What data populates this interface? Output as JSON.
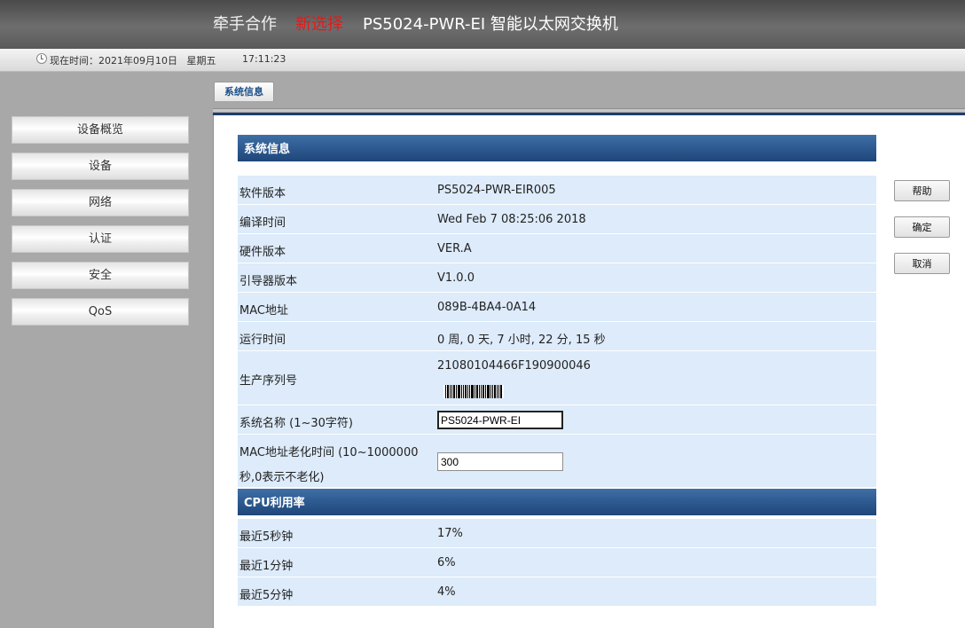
{
  "header": {
    "brand": "牵手合作",
    "brand_highlight": "新选择",
    "product": "PS5024-PWR-EI 智能以太网交换机"
  },
  "timebar": {
    "label": "现在时间：2021年09月10日   星期五",
    "time": "17:11:23"
  },
  "sidebar": {
    "items": [
      {
        "label": "设备概览"
      },
      {
        "label": "设备"
      },
      {
        "label": "网络"
      },
      {
        "label": "认证"
      },
      {
        "label": "安全"
      },
      {
        "label": "QoS"
      }
    ]
  },
  "tab": {
    "label": "系统信息"
  },
  "system_info": {
    "title": "系统信息",
    "rows": [
      {
        "label": "软件版本",
        "value": "PS5024-PWR-EIR005"
      },
      {
        "label": "编译时间",
        "value": "Wed Feb 7 08:25:06 2018"
      },
      {
        "label": "硬件版本",
        "value": "VER.A"
      },
      {
        "label": "引导器版本",
        "value": "V1.0.0"
      },
      {
        "label": "MAC地址",
        "value": "089B-4BA4-0A14"
      },
      {
        "label": "运行时间",
        "value": "0 周, 0 天, 7 小时, 22 分, 15 秒"
      },
      {
        "label": "生产序列号",
        "value": "21080104466F190900046"
      }
    ],
    "name_field": {
      "label": "系统名称 (1~30字符)",
      "value": "PS5024-PWR-EI"
    },
    "aging_field": {
      "label_line1": "MAC地址老化时间 (10~1000000",
      "label_line2": "秒,0表示不老化)",
      "value": "300"
    }
  },
  "cpu": {
    "title": "CPU利用率",
    "rows": [
      {
        "label": "最近5秒钟",
        "value": "17%"
      },
      {
        "label": "最近1分钟",
        "value": "6%"
      },
      {
        "label": "最近5分钟",
        "value": "4%"
      }
    ]
  },
  "buttons": {
    "help": "帮助",
    "ok": "确定",
    "cancel": "取消"
  }
}
